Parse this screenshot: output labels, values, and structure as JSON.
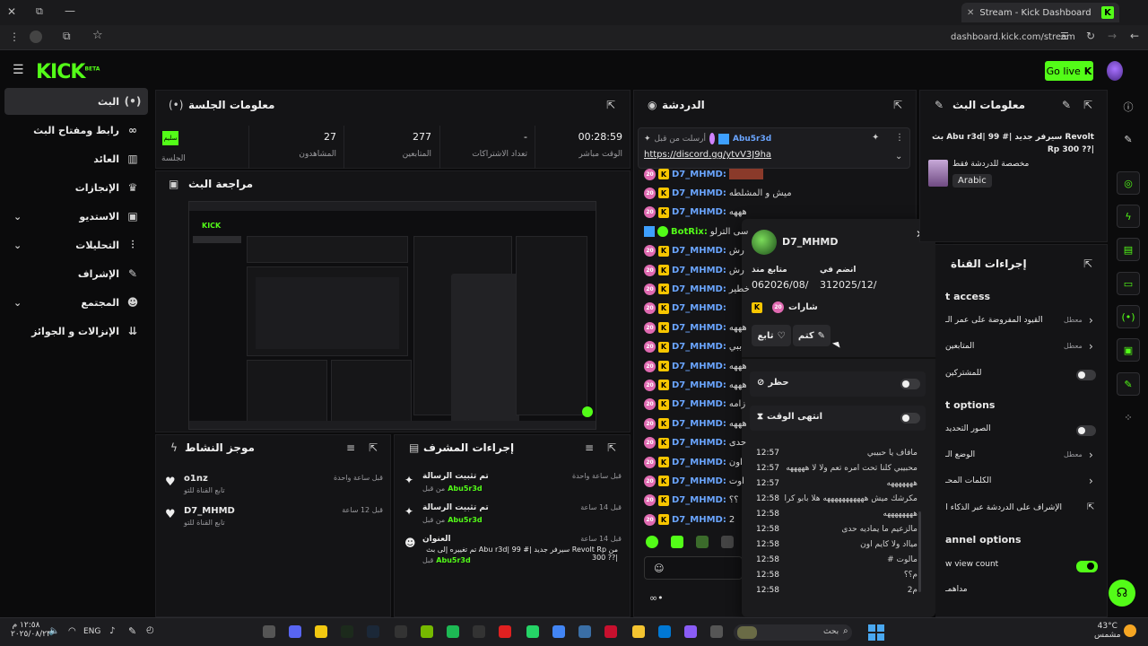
{
  "browser": {
    "tab_title": "Stream - Kick Dashboard",
    "url": "dashboard.kick.com/stream"
  },
  "header": {
    "logo": "KICK",
    "logo_sup": "BETA",
    "go_live": "Go live"
  },
  "sidebar": {
    "items": [
      {
        "label": "البث",
        "icon": "broadcast-icon"
      },
      {
        "label": "رابط ومفتاح البث",
        "icon": "link-icon"
      },
      {
        "label": "العائد",
        "icon": "chart-icon"
      },
      {
        "label": "الإنجازات",
        "icon": "trophy-icon"
      },
      {
        "label": "الاستديو",
        "icon": "studio-icon"
      },
      {
        "label": "التحليلات",
        "icon": "analytics-icon"
      },
      {
        "label": "الإشراف",
        "icon": "wrench-icon"
      },
      {
        "label": "المجتمع",
        "icon": "community-icon"
      },
      {
        "label": "الإنزالات و الجوائز",
        "icon": "drops-icon"
      }
    ]
  },
  "session": {
    "title": "معلومات الجلسة",
    "badge": "سليم",
    "badge_label": "الجلسة",
    "stats": [
      {
        "value": "27",
        "label": "المشاهدون"
      },
      {
        "value": "277",
        "label": "المتابعين"
      },
      {
        "value": "-",
        "label": "تعداد الاشتراكات"
      },
      {
        "value": "00:28:59",
        "label": "الوقت مباشر"
      }
    ]
  },
  "preview": {
    "title": "مراجعة البث"
  },
  "activity": {
    "title": "موجز النشاط",
    "items": [
      {
        "user": "o1nz",
        "sub": "تابع القناة للتو",
        "time": "قبل ساعة واحدة"
      },
      {
        "user": "D7_MHMD",
        "sub": "تابع القناة للتو",
        "time": "قبل 12 ساعة"
      }
    ]
  },
  "mod_actions": {
    "title": "إجراءات المشرف",
    "items": [
      {
        "title": "تم تثبيت الرسالة",
        "by": "من قبل",
        "user": "Abu5r3d",
        "time": "قبل ساعة واحدة"
      },
      {
        "title": "تم تثبيت الرسالة",
        "by": "من قبل",
        "user": "Abu5r3d",
        "time": "قبل 14 ساعة"
      },
      {
        "title": "العنوان",
        "detail": "من Revolt Rp سيرفر جديد |# 99 |Abu r3d تم تغييره إلى بث |?? 300",
        "by": "قبل",
        "user": "Abu5r3d",
        "time": "قبل 14 ساعة"
      }
    ]
  },
  "chat": {
    "title": "الدردشة",
    "pinned_by": "أرسلت من قبل",
    "pinned_user": "Abu5r3d",
    "pinned_link": "https://discord.gg/ytvV3J9ha",
    "lines": [
      {
        "user": "D7_MHMD:",
        "text": ""
      },
      {
        "user": "D7_MHMD:",
        "text": "ميش و المشلطه"
      },
      {
        "user": "D7_MHMD:",
        "text": "هههه"
      },
      {
        "user": "BotRix:",
        "text": "سى الترلو"
      },
      {
        "user": "D7_MHMD:",
        "text": "رش"
      },
      {
        "user": "D7_MHMD:",
        "text": "رش"
      },
      {
        "user": "D7_MHMD:",
        "text": "خطير"
      },
      {
        "user": "D7_MHMD:",
        "text": ""
      },
      {
        "user": "D7_MHMD:",
        "text": "هههه"
      },
      {
        "user": "D7_MHMD:",
        "text": "ببي"
      },
      {
        "user": "D7_MHMD:",
        "text": "هههه"
      },
      {
        "user": "D7_MHMD:",
        "text": "هههه"
      },
      {
        "user": "D7_MHMD:",
        "text": "زامه"
      },
      {
        "user": "D7_MHMD:",
        "text": "هههه"
      },
      {
        "user": "D7_MHMD:",
        "text": "حدى"
      },
      {
        "user": "D7_MHMD:",
        "text": "اون"
      },
      {
        "user": "D7_MHMD:",
        "text": "اوت"
      },
      {
        "user": "D7_MHMD:",
        "text": "؟؟"
      },
      {
        "user": "D7_MHMD:",
        "text": "2"
      }
    ]
  },
  "user_card": {
    "username": "D7_MHMD",
    "following_since_label": "متابع منذ",
    "following_since": "062026/08/",
    "joined_label": "انضم في",
    "joined": "312025/12/",
    "badges_label": "شارات",
    "follow_btn": "تابع",
    "mute_btn": "كتم",
    "ban_label": "حظر",
    "timeout_label": "انتهى الوقت",
    "log": [
      {
        "time": "12:57",
        "msg": "مافاف يا حبيبي"
      },
      {
        "time": "12:57",
        "msg": "محبيبي كلنا تحت امره تعم ولا لا هههههه"
      },
      {
        "time": "12:57",
        "msg": "هههههههه"
      },
      {
        "time": "12:58",
        "msg": "مكرشك ميش هههههههههههه هلا بابو كرامه"
      },
      {
        "time": "12:58",
        "msg": "ههههههههه"
      },
      {
        "time": "12:58",
        "msg": "مالزعيم ما يماديه حدى"
      },
      {
        "time": "12:58",
        "msg": "ميااد ولا كايم اون"
      },
      {
        "time": "12:58",
        "msg": "مالوت #"
      },
      {
        "time": "12:58",
        "msg": "م؟؟"
      },
      {
        "time": "12:58",
        "msg": "م2"
      }
    ]
  },
  "stream_info": {
    "title": "معلومات البث",
    "stream_title": "Revolt سيرفر جديد |# 99 |Abu r3d بث |?? 300 Rp",
    "category": "مخصصة للدردشة فقط",
    "language": "Arabic"
  },
  "channel_actions": {
    "title": "إجراءات القناة",
    "section1": "t access",
    "rows1": [
      {
        "label": "القيود المفروضة على عمر الـ",
        "state": "معطل"
      },
      {
        "label": "المتابعين",
        "state": "معطل"
      },
      {
        "label": "للمشتركين",
        "state": ""
      }
    ],
    "section2": "t options",
    "rows2": [
      {
        "label": "الصور التحديد",
        "state": ""
      },
      {
        "label": "الوضع الـ",
        "state": "معطل"
      },
      {
        "label": "الكلمات المحـ",
        "state": ""
      },
      {
        "label": "الإشراف على الدردشة عبر الذكاء الاصـ",
        "state": ""
      }
    ],
    "section3": "annel options",
    "rows3": [
      {
        "label": "w view count",
        "state": ""
      },
      {
        "label": "مداهمـ",
        "state": ""
      }
    ]
  },
  "taskbar": {
    "clock_time": "١٢:٥٨ م",
    "clock_date": "٢٠٢٥/٠٨/٢٣",
    "lang": "ENG",
    "search_placeholder": "بحث",
    "weather_temp": "43°C",
    "weather_desc": "مشمس"
  },
  "colors": {
    "accent": "#53fc18",
    "link": "#6aa5ff",
    "badge_pink": "#e06ab1",
    "badge_gold": "#f7c600"
  }
}
